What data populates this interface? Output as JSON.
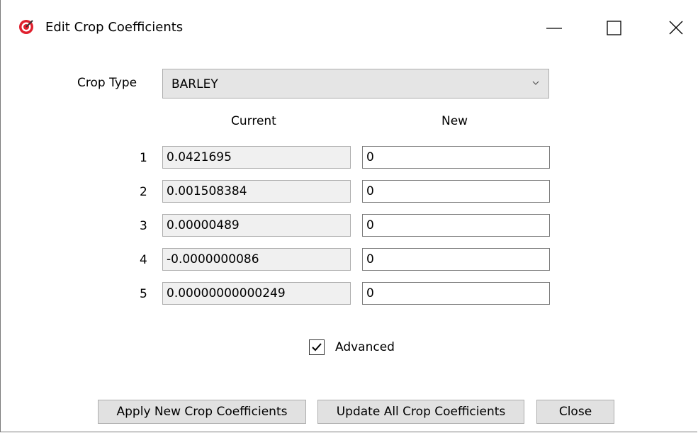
{
  "window": {
    "title": "Edit Crop Coefficients",
    "icon": "target-icon",
    "accent_color": "#e0202e",
    "controls": {
      "minimize": "minimize-icon",
      "maximize": "maximize-icon",
      "close": "close-icon"
    }
  },
  "form": {
    "crop_type_label": "Crop Type",
    "crop_type_value": "BARLEY",
    "current_header": "Current",
    "new_header": "New",
    "rows": [
      {
        "index": "1",
        "current": "0.0421695",
        "new": "0"
      },
      {
        "index": "2",
        "current": "0.001508384",
        "new": "0"
      },
      {
        "index": "3",
        "current": "0.00000489",
        "new": "0"
      },
      {
        "index": "4",
        "current": "-0.0000000086",
        "new": "0"
      },
      {
        "index": "5",
        "current": "0.00000000000249",
        "new": "0"
      }
    ],
    "advanced_label": "Advanced",
    "advanced_checked": true
  },
  "buttons": {
    "apply": "Apply New Crop Coefficients",
    "update": "Update All Crop Coefficients",
    "close": "Close"
  }
}
